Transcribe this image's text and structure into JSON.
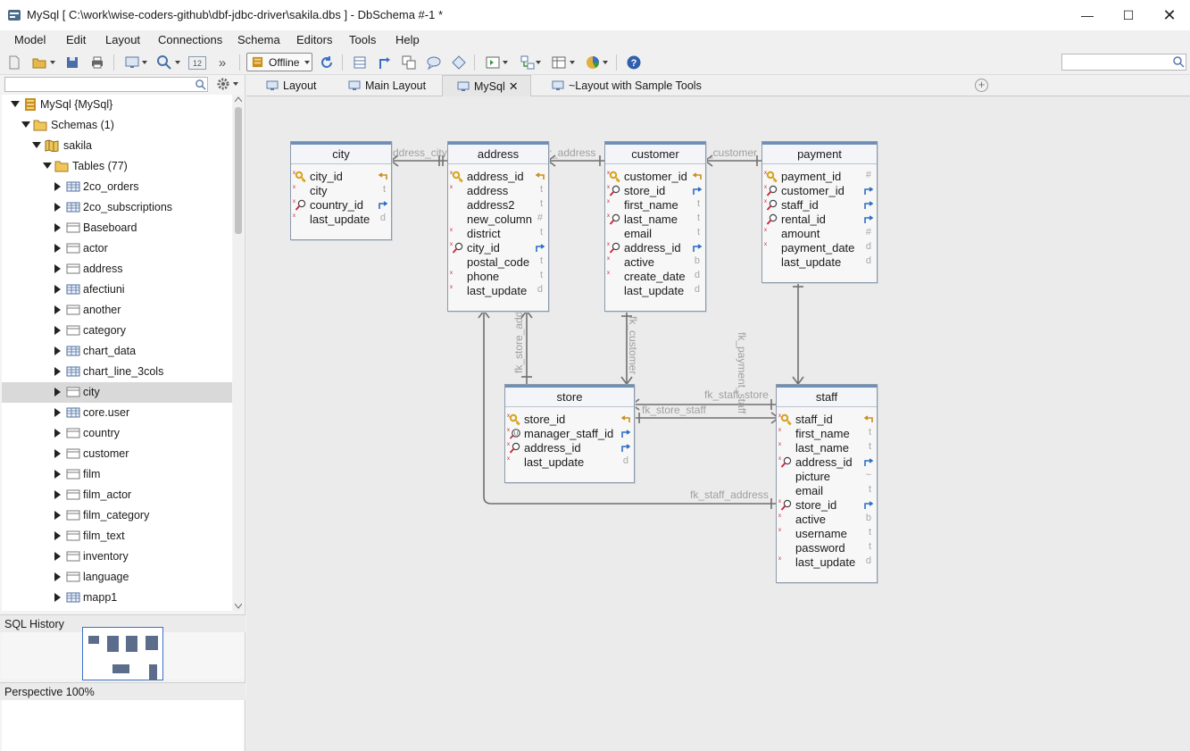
{
  "window": {
    "title": "MySql [ C:\\work\\wise-coders-github\\dbf-jdbc-driver\\sakila.dbs ] - DbSchema #-1 *",
    "controls": [
      "minimize",
      "maximize",
      "close"
    ]
  },
  "menu": [
    "Model",
    "Edit",
    "Layout",
    "Connections",
    "Schema",
    "Editors",
    "Tools",
    "Help"
  ],
  "toolbar": {
    "connection_status": "Offline",
    "zoom_box": "12",
    "search_placeholder": ""
  },
  "tree": {
    "search_placeholder": "",
    "root": "MySql {MySql}",
    "schemas": "Schemas (1)",
    "schema": "sakila",
    "tables": "Tables (77)",
    "items": [
      {
        "label": "2co_orders",
        "kind": "table-grid"
      },
      {
        "label": "2co_subscriptions",
        "kind": "table-grid"
      },
      {
        "label": "Baseboard",
        "kind": "table"
      },
      {
        "label": "actor",
        "kind": "table"
      },
      {
        "label": "address",
        "kind": "table"
      },
      {
        "label": "afectiuni",
        "kind": "table-grid"
      },
      {
        "label": "another",
        "kind": "table"
      },
      {
        "label": "category",
        "kind": "table"
      },
      {
        "label": "chart_data",
        "kind": "table-grid"
      },
      {
        "label": "chart_line_3cols",
        "kind": "table-grid"
      },
      {
        "label": "city",
        "kind": "table",
        "selected": true
      },
      {
        "label": "core.user",
        "kind": "table-grid"
      },
      {
        "label": "country",
        "kind": "table"
      },
      {
        "label": "customer",
        "kind": "table"
      },
      {
        "label": "film",
        "kind": "table"
      },
      {
        "label": "film_actor",
        "kind": "table"
      },
      {
        "label": "film_category",
        "kind": "table"
      },
      {
        "label": "film_text",
        "kind": "table"
      },
      {
        "label": "inventory",
        "kind": "table"
      },
      {
        "label": "language",
        "kind": "table"
      },
      {
        "label": "mapp1",
        "kind": "table-grid"
      }
    ]
  },
  "panels": {
    "sql_history": "SQL History",
    "perspective": "Perspective 100%"
  },
  "tabs": [
    {
      "label": "Layout",
      "active": false
    },
    {
      "label": "Main Layout",
      "active": false
    },
    {
      "label": "MySql",
      "active": true,
      "closable": true
    },
    {
      "label": "~Layout with Sample Tools",
      "active": false
    }
  ],
  "entities": {
    "city": {
      "name": "city",
      "columns": [
        {
          "name": "city_id",
          "type": "",
          "req": true,
          "icon": "key"
        },
        {
          "name": "city",
          "type": "t",
          "req": true,
          "icon": ""
        },
        {
          "name": "country_id",
          "type": "",
          "req": true,
          "icon": "fk"
        },
        {
          "name": "last_update",
          "type": "d",
          "req": true,
          "icon": ""
        }
      ]
    },
    "address": {
      "name": "address",
      "columns": [
        {
          "name": "address_id",
          "type": "",
          "req": true,
          "icon": "key"
        },
        {
          "name": "address",
          "type": "t",
          "req": true,
          "icon": ""
        },
        {
          "name": "address2",
          "type": "t",
          "req": false,
          "icon": ""
        },
        {
          "name": "new_column",
          "type": "#",
          "req": false,
          "icon": ""
        },
        {
          "name": "district",
          "type": "t",
          "req": true,
          "icon": ""
        },
        {
          "name": "city_id",
          "type": "",
          "req": true,
          "icon": "fk"
        },
        {
          "name": "postal_code",
          "type": "t",
          "req": false,
          "icon": ""
        },
        {
          "name": "phone",
          "type": "t",
          "req": true,
          "icon": ""
        },
        {
          "name": "last_update",
          "type": "d",
          "req": true,
          "icon": ""
        }
      ]
    },
    "customer": {
      "name": "customer",
      "columns": [
        {
          "name": "customer_id",
          "type": "",
          "req": true,
          "icon": "key"
        },
        {
          "name": "store_id",
          "type": "",
          "req": true,
          "icon": "fk"
        },
        {
          "name": "first_name",
          "type": "t",
          "req": true,
          "icon": ""
        },
        {
          "name": "last_name",
          "type": "t",
          "req": true,
          "icon": "idx"
        },
        {
          "name": "email",
          "type": "t",
          "req": false,
          "icon": ""
        },
        {
          "name": "address_id",
          "type": "",
          "req": true,
          "icon": "fk"
        },
        {
          "name": "active",
          "type": "b",
          "req": true,
          "icon": ""
        },
        {
          "name": "create_date",
          "type": "d",
          "req": true,
          "icon": ""
        },
        {
          "name": "last_update",
          "type": "d",
          "req": false,
          "icon": ""
        }
      ]
    },
    "payment": {
      "name": "payment",
      "columns": [
        {
          "name": "payment_id",
          "type": "#",
          "req": true,
          "icon": "key"
        },
        {
          "name": "customer_id",
          "type": "",
          "req": true,
          "icon": "fk"
        },
        {
          "name": "staff_id",
          "type": "",
          "req": true,
          "icon": "fk"
        },
        {
          "name": "rental_id",
          "type": "",
          "req": false,
          "icon": "fk"
        },
        {
          "name": "amount",
          "type": "#",
          "req": true,
          "icon": ""
        },
        {
          "name": "payment_date",
          "type": "d",
          "req": true,
          "icon": ""
        },
        {
          "name": "last_update",
          "type": "d",
          "req": false,
          "icon": ""
        }
      ]
    },
    "store": {
      "name": "store",
      "columns": [
        {
          "name": "store_id",
          "type": "",
          "req": true,
          "icon": "key"
        },
        {
          "name": "manager_staff_id",
          "type": "",
          "req": true,
          "icon": "uniq"
        },
        {
          "name": "address_id",
          "type": "",
          "req": true,
          "icon": "fk"
        },
        {
          "name": "last_update",
          "type": "d",
          "req": true,
          "icon": ""
        }
      ]
    },
    "staff": {
      "name": "staff",
      "columns": [
        {
          "name": "staff_id",
          "type": "",
          "req": true,
          "icon": "key"
        },
        {
          "name": "first_name",
          "type": "t",
          "req": true,
          "icon": ""
        },
        {
          "name": "last_name",
          "type": "t",
          "req": true,
          "icon": ""
        },
        {
          "name": "address_id",
          "type": "",
          "req": true,
          "icon": "fk"
        },
        {
          "name": "picture",
          "type": "~",
          "req": false,
          "icon": ""
        },
        {
          "name": "email",
          "type": "t",
          "req": false,
          "icon": ""
        },
        {
          "name": "store_id",
          "type": "",
          "req": true,
          "icon": "fk"
        },
        {
          "name": "active",
          "type": "b",
          "req": true,
          "icon": ""
        },
        {
          "name": "username",
          "type": "t",
          "req": true,
          "icon": ""
        },
        {
          "name": "password",
          "type": "t",
          "req": false,
          "icon": ""
        },
        {
          "name": "last_update",
          "type": "d",
          "req": true,
          "icon": ""
        }
      ]
    }
  },
  "relations": {
    "address_city": "ddress_city",
    "customer_address": "r_address",
    "payment_customer": "_customer",
    "payment_staff": "fk_payment_staff",
    "customer_store": "fk_customer",
    "store_address": "fk_store_add",
    "staff_store": "fk_staff_store",
    "store_staff": "fk_store_staff",
    "staff_address": "fk_staff_address"
  },
  "colors": {
    "entity_header_accent": "#6e8fb8",
    "link": "#707070",
    "key_icon": "#d7a21a",
    "fk_arrow": "#2b6cc4",
    "selection": "#d9d9d9"
  }
}
